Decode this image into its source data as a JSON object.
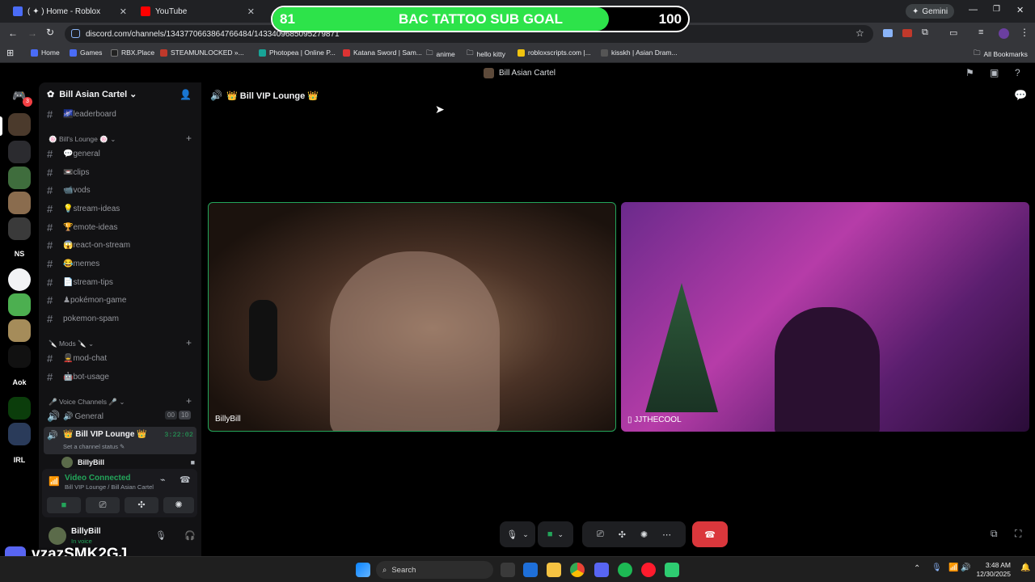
{
  "browser": {
    "tabs": [
      {
        "title": "( ✦ ) Home - Roblox"
      },
      {
        "title": "YouTube"
      }
    ],
    "gemini_label": "Gemini",
    "url": "discord.com/channels/1343770663864766484/1433409685095279871",
    "bookmarks": [
      {
        "label": "Home"
      },
      {
        "label": "Games"
      },
      {
        "label": "RBX.Place"
      },
      {
        "label": "STEAMUNLOCKED »..."
      },
      {
        "label": "Photopea | Online P..."
      },
      {
        "label": "Katana Sword | Sam..."
      },
      {
        "label": "anime"
      },
      {
        "label": "hello kitty"
      },
      {
        "label": "robloxscripts.com |..."
      },
      {
        "label": "kisskh | Asian Dram..."
      }
    ],
    "all_bookmarks_label": "All Bookmarks"
  },
  "goal": {
    "current": "81",
    "title": "BAC TATTOO SUB GOAL",
    "target": "100",
    "progress": 0.81,
    "fill_color": "#2de34a"
  },
  "discord": {
    "title_bar": "Bill Asian Cartel",
    "server_name": "Bill Asian Cartel",
    "dm_badge": "3",
    "server_icons": [
      "NS",
      "Aok",
      "IRL"
    ],
    "channels_top": [
      {
        "emoji": "🌌",
        "name": "leaderboard"
      }
    ],
    "category_lounge": "Bill's Lounge",
    "lounge_channels": [
      {
        "emoji": "💬",
        "name": "general"
      },
      {
        "emoji": "📼",
        "name": "clips"
      },
      {
        "emoji": "📹",
        "name": "vods"
      },
      {
        "emoji": "💡",
        "name": "stream-ideas"
      },
      {
        "emoji": "🏆",
        "name": "emote-ideas"
      },
      {
        "emoji": "😱",
        "name": "react-on-stream"
      },
      {
        "emoji": "😂",
        "name": "memes"
      },
      {
        "emoji": "📄",
        "name": "stream-tips"
      },
      {
        "emoji": "♟",
        "name": "pokémon-game"
      },
      {
        "emoji": "",
        "name": "pokemon-spam"
      }
    ],
    "category_mods": "Mods",
    "mod_channels": [
      {
        "emoji": "💂",
        "name": "mod-chat"
      },
      {
        "emoji": "🤖",
        "name": "bot-usage"
      }
    ],
    "category_voice": "Voice Channels",
    "voice_channels": [
      {
        "name": "General",
        "count": "00",
        "limit": "10"
      },
      {
        "name": "Bill VIP Lounge",
        "timer": "3:22:02",
        "status": "Set a channel status"
      }
    ],
    "voice_member": "BillyBill",
    "connection": {
      "status": "Video Connected",
      "location": "Bill VIP Lounge / Bill Asian Cartel"
    },
    "user": {
      "name": "BillyBill",
      "status": "In voice"
    },
    "overlay_code": "vzazSMK2GJ",
    "header_channel": "Bill VIP Lounge",
    "participants": [
      {
        "name": "BillyBill"
      },
      {
        "name": "JJTHECOOL"
      }
    ]
  },
  "taskbar": {
    "search_placeholder": "Search",
    "time": "3:48 AM",
    "date": "12/30/2025"
  }
}
